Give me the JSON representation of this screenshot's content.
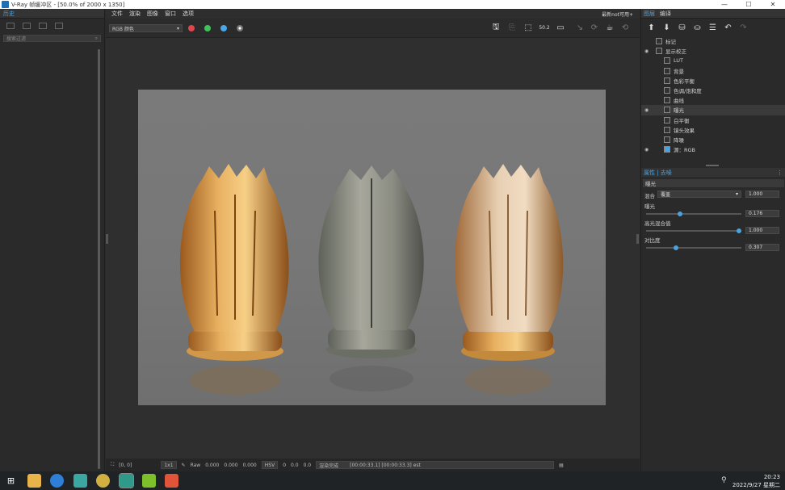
{
  "window": {
    "title": "V-Ray 帧缓冲区 - [50.0% of 2000 x 1350]",
    "min": "—",
    "max": "☐",
    "close": "✕"
  },
  "left_panel": {
    "tab": "历史",
    "search_placeholder": "搜索过滤"
  },
  "menu": {
    "items": [
      "文件",
      "渲染",
      "图像",
      "窗口",
      "选项"
    ],
    "right_label": "最新not可用+"
  },
  "toolbar": {
    "channel": "RGB 颜色",
    "colors": {
      "red": "#e0474c",
      "green": "#3cc45a",
      "blue": "#4aa6e8"
    }
  },
  "status": {
    "coords": "[0, 0]",
    "mode": "1x1",
    "raw": "Raw",
    "vals": [
      "0.000",
      "0.000",
      "0.000"
    ],
    "space": "HSV",
    "hsv": [
      "0",
      "0.0",
      "0.0"
    ],
    "msg": "渲染完成",
    "time": "[00:00:33.1] [00:00:33.3] est"
  },
  "right_panel": {
    "tabs": [
      "图层",
      "编译"
    ],
    "layers": [
      {
        "name": "标记",
        "eye": false
      },
      {
        "name": "显示校正",
        "eye": true
      },
      {
        "name": "LUT",
        "eye": false
      },
      {
        "name": "背景",
        "eye": false
      },
      {
        "name": "色彩平衡",
        "eye": false
      },
      {
        "name": "色调/饱和度",
        "eye": false
      },
      {
        "name": "曲线",
        "eye": false
      },
      {
        "name": "曝光",
        "eye": true,
        "selected": true
      },
      {
        "name": "白平衡",
        "eye": false
      },
      {
        "name": "镜头效果",
        "eye": false
      },
      {
        "name": "降噪",
        "eye": false
      },
      {
        "name": "源：RGB",
        "eye": true
      }
    ],
    "props_tab": "属性 | 去噪",
    "props_title": "曝光",
    "blend_label": "混合",
    "blend_mode": "覆盖",
    "blend_value": "1.000",
    "exposure_label": "曝光",
    "exposure_value": "0.176",
    "exposure_level": 0.35,
    "highlight_label": "高光混合值",
    "highlight_value": "1.000",
    "highlight_level": 1.0,
    "contrast_label": "对比度",
    "contrast_value": "0.307",
    "contrast_level": 0.3
  },
  "taskbar": {
    "time": "20:23",
    "date": "2022/9/27 星期二"
  }
}
